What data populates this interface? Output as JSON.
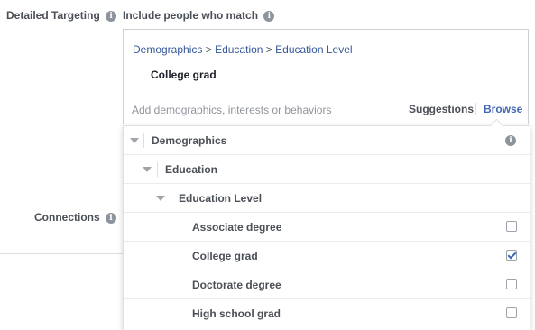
{
  "detailed_targeting": {
    "label": "Detailed Targeting",
    "sublabel": "Include people who match",
    "breadcrumb": [
      "Demographics",
      "Education",
      "Education Level"
    ],
    "breadcrumb_sep": ">",
    "selected_item": "College grad",
    "search_placeholder": "Add demographics, interests or behaviors",
    "tabs": {
      "suggestions": "Suggestions",
      "browse": "Browse"
    },
    "info_glyph": "i"
  },
  "connections": {
    "label": "Connections"
  },
  "browse_tree": [
    {
      "label": "Demographics",
      "level": 0,
      "expanded": true
    },
    {
      "label": "Education",
      "level": 1,
      "expanded": true
    },
    {
      "label": "Education Level",
      "level": 2,
      "expanded": true
    },
    {
      "label": "Associate degree",
      "level": 3,
      "checked": false
    },
    {
      "label": "College grad",
      "level": 3,
      "checked": true
    },
    {
      "label": "Doctorate degree",
      "level": 3,
      "checked": false
    },
    {
      "label": "High school grad",
      "level": 3,
      "checked": false
    }
  ],
  "colors": {
    "link": "#365899",
    "accent": "#4267b2",
    "label": "#4b4f56"
  },
  "icons": {
    "info": "info-circle-icon",
    "expand": "triangle-down-icon",
    "checkbox": "checkbox-icon"
  }
}
